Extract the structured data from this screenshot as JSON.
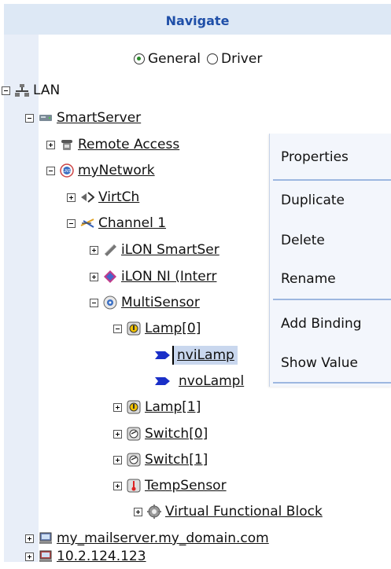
{
  "header": {
    "title": "Navigate"
  },
  "radio": {
    "general": "General",
    "driver": "Driver"
  },
  "tree": {
    "lan": "LAN",
    "smartserver": "SmartServer",
    "remote_access": "Remote Access",
    "mynetwork": "myNetwork",
    "virtch": "VirtCh",
    "channel1": "Channel 1",
    "ilon_smartserver": "iLON SmartSer",
    "ilon_ni": "iLON NI (Interr",
    "multisensor": "MultiSensor",
    "lamp0": "Lamp[0]",
    "nvilamp": "nviLamp",
    "nvolamp": "nvoLampl",
    "lamp1": "Lamp[1]",
    "switch0": "Switch[0]",
    "switch1": "Switch[1]",
    "tempsensor": "TempSensor",
    "vfb": "Virtual Functional Block",
    "mailserver": "my_mailserver.my_domain.com",
    "ip": "10.2.124.123"
  },
  "context_menu": {
    "properties": "Properties",
    "duplicate": "Duplicate",
    "delete": "Delete",
    "rename": "Rename",
    "add_binding": "Add Binding",
    "show_value": "Show Value"
  }
}
